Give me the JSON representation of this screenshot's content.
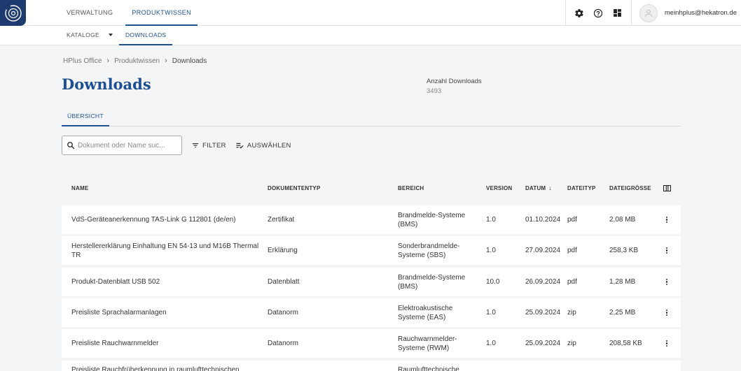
{
  "header": {
    "nav": [
      {
        "label": "VERWALTUNG",
        "active": false
      },
      {
        "label": "PRODUKTWISSEN",
        "active": true
      }
    ],
    "icons": [
      "settings-icon",
      "help-icon",
      "apps-icon"
    ],
    "user_email": "meinhplus@hekatron.de"
  },
  "subnav": {
    "items": [
      {
        "label": "KATALOGE",
        "active": false,
        "dropdown": true
      },
      {
        "label": "DOWNLOADS",
        "active": true
      }
    ]
  },
  "breadcrumb": [
    "HPlus Office",
    "Produktwissen",
    "Downloads"
  ],
  "page": {
    "title": "Downloads",
    "stat_label": "Anzahl Downloads",
    "stat_value": "3493",
    "tab": "ÜBERSICHT"
  },
  "toolbar": {
    "search_placeholder": "Dokument oder Name suc...",
    "filter_label": "FILTER",
    "select_label": "AUSWÄHLEN"
  },
  "table": {
    "columns": {
      "name": "NAME",
      "type": "DOKUMENTENTYP",
      "area": "BEREICH",
      "version": "VERSION",
      "date": "DATUM",
      "filetype": "DATEITYP",
      "size": "DATEIGRÖSSE"
    },
    "sort_indicator": "↓",
    "rows": [
      {
        "name": "VdS-Geräteanerkennung TAS-Link G 112801 (de/en)",
        "type": "Zertifikat",
        "area": "Brandmelde-Systeme (BMS)",
        "version": "1.0",
        "date": "01.10.2024",
        "filetype": "pdf",
        "size": "2,08 MB"
      },
      {
        "name": "Herstellererklärung Einhaltung EN 54-13 und M16B Thermal TR",
        "type": "Erklärung",
        "area": "Sonderbrandmelde-Systeme (SBS)",
        "version": "1.0",
        "date": "27.09.2024",
        "filetype": "pdf",
        "size": "258,3 KB"
      },
      {
        "name": "Produkt-Datenblatt USB 502",
        "type": "Datenblatt",
        "area": "Brandmelde-Systeme (BMS)",
        "version": "10.0",
        "date": "26.09.2024",
        "filetype": "pdf",
        "size": "1,28 MB"
      },
      {
        "name": "Preisliste Sprachalarmanlagen",
        "type": "Datanorm",
        "area": "Elektroakustische Systeme (EAS)",
        "version": "1.0",
        "date": "25.09.2024",
        "filetype": "zip",
        "size": "2,25 MB"
      },
      {
        "name": "Preisliste Rauchwarnmelder",
        "type": "Datanorm",
        "area": "Rauchwarnmelder-Systeme (RWM)",
        "version": "1.0",
        "date": "25.09.2024",
        "filetype": "zip",
        "size": "208,58 KB"
      },
      {
        "name": "Preisliste Rauchfrüherkennung in raumlufttechnischen",
        "type": "",
        "area": "Raumlufttechnische",
        "version": "",
        "date": "",
        "filetype": "",
        "size": ""
      }
    ]
  }
}
